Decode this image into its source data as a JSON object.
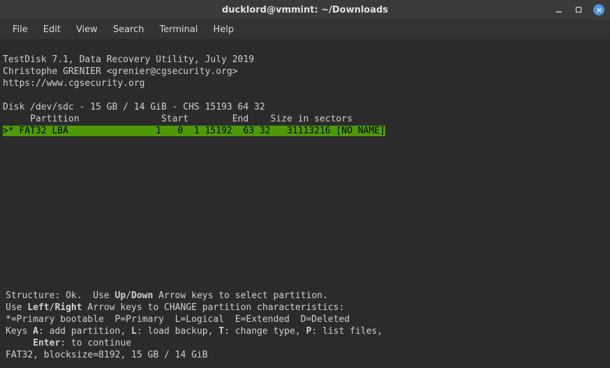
{
  "window": {
    "title": "ducklord@vmmint: ~/Downloads"
  },
  "menu": {
    "file": "File",
    "edit": "Edit",
    "view": "View",
    "search": "Search",
    "terminal": "Terminal",
    "help": "Help"
  },
  "header": {
    "line1": "TestDisk 7.1, Data Recovery Utility, July 2019",
    "line2": "Christophe GRENIER <grenier@cgsecurity.org>",
    "line3": "https://www.cgsecurity.org"
  },
  "disk": {
    "info": "Disk /dev/sdc - 15 GB / 14 GiB - CHS 15193 64 32",
    "colhead": "     Partition               Start        End    Size in sectors"
  },
  "partition": {
    "row": ">* FAT32 LBA                1   0  1 15192  63 32   31113216 [NO NAME]"
  },
  "hints": {
    "l1a": "Structure: Ok.  Use ",
    "l1b": "Up",
    "l1c": "/",
    "l1d": "Down",
    "l1e": " Arrow keys to select partition.",
    "l2a": "Use ",
    "l2b": "Left",
    "l2c": "/",
    "l2d": "Right",
    "l2e": " Arrow keys to CHANGE partition characteristics:",
    "l3": "*=Primary bootable  P=Primary  L=Logical  E=Extended  D=Deleted",
    "l4a": "Keys ",
    "l4b": "A",
    "l4c": ": add partition, ",
    "l4d": "L",
    "l4e": ": load backup, ",
    "l4f": "T",
    "l4g": ": change type, ",
    "l4h": "P",
    "l4i": ": list files,",
    "l5a": "     ",
    "l5b": "Enter",
    "l5c": ": to continue",
    "l6": "FAT32, blocksize=8192, 15 GB / 14 GiB"
  }
}
